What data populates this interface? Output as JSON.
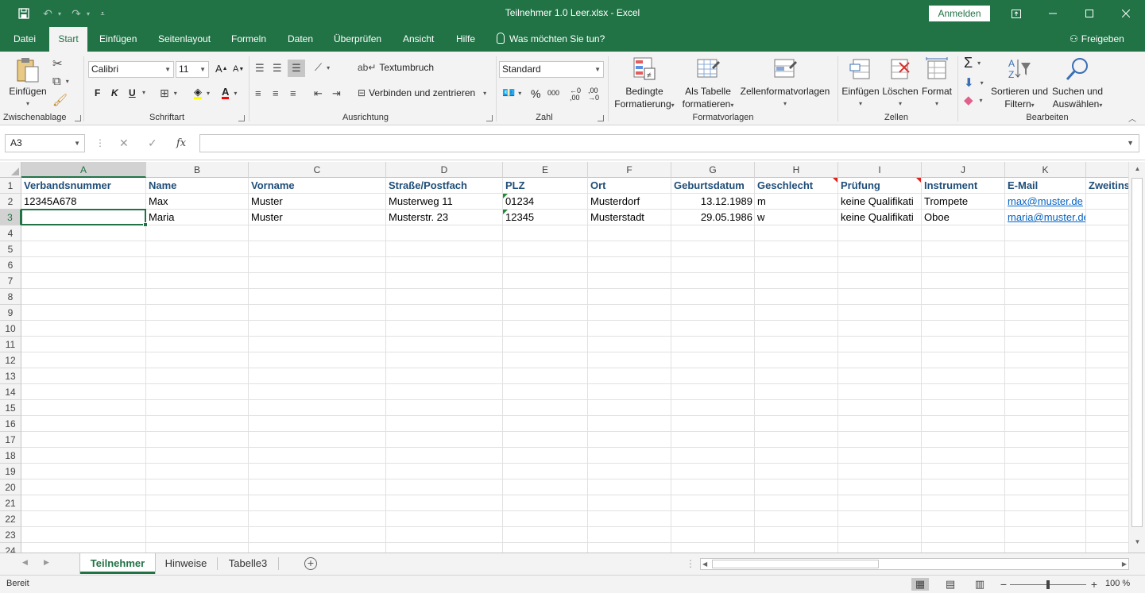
{
  "window": {
    "title": "Teilnehmer 1.0 Leer.xlsx  -  Excel",
    "signin_label": "Anmelden"
  },
  "ribbon_tabs": [
    "Datei",
    "Start",
    "Einfügen",
    "Seitenlayout",
    "Formeln",
    "Daten",
    "Überprüfen",
    "Ansicht",
    "Hilfe"
  ],
  "tell_me": "Was möchten Sie tun?",
  "share_label": "Freigeben",
  "ribbon": {
    "clipboard": {
      "paste": "Einfügen",
      "group": "Zwischenablage"
    },
    "font": {
      "name": "Calibri",
      "size": "11",
      "bold": "F",
      "italic": "K",
      "underline": "U",
      "group": "Schriftart"
    },
    "alignment": {
      "wrap": "Textumbruch",
      "merge": "Verbinden und zentrieren",
      "group": "Ausrichtung"
    },
    "number": {
      "format": "Standard",
      "percent": "%",
      "thousands": "000",
      "group": "Zahl"
    },
    "styles": {
      "conditional_l1": "Bedingte",
      "conditional_l2": "Formatierung",
      "table_l1": "Als Tabelle",
      "table_l2": "formatieren",
      "cellstyles": "Zellenformatvorlagen",
      "group": "Formatvorlagen"
    },
    "cells": {
      "insert": "Einfügen",
      "delete": "Löschen",
      "format": "Format",
      "group": "Zellen"
    },
    "editing": {
      "sort_l1": "Sortieren und",
      "sort_l2": "Filtern",
      "find_l1": "Suchen und",
      "find_l2": "Auswählen",
      "group": "Bearbeiten"
    }
  },
  "formula_bar": {
    "name_box": "A3",
    "fx": "fx",
    "value": ""
  },
  "columns": [
    "A",
    "B",
    "C",
    "D",
    "E",
    "F",
    "G",
    "H",
    "I",
    "J",
    "K"
  ],
  "rows": [
    "1",
    "2",
    "3",
    "4",
    "5",
    "6",
    "7",
    "8",
    "9",
    "10",
    "11",
    "12",
    "13",
    "14",
    "15",
    "16",
    "17",
    "18",
    "19",
    "20",
    "21",
    "22",
    "23",
    "24"
  ],
  "header_row": [
    "Verbandsnummer",
    "Name",
    "Vorname",
    "Straße/Postfach",
    "PLZ",
    "Ort",
    "Geburtsdatum",
    "Geschlecht",
    "Prüfung",
    "Instrument",
    "E-Mail",
    "Zweitins"
  ],
  "data_rows": [
    [
      "12345A678",
      "Max",
      "Muster",
      "Musterweg 11",
      "01234",
      "Musterdorf",
      "13.12.1989",
      "m",
      "keine Qualifikati",
      "Trompete",
      "max@muster.de",
      ""
    ],
    [
      "",
      "Maria",
      "Muster",
      "Musterstr. 23",
      "12345",
      "Musterstadt",
      "29.05.1986",
      "w",
      "keine Qualifikati",
      "Oboe",
      "maria@muster.de",
      ""
    ]
  ],
  "sheets": [
    "Teilnehmer",
    "Hinweise",
    "Tabelle3"
  ],
  "status": {
    "text": "Bereit",
    "zoom": "100 %"
  }
}
